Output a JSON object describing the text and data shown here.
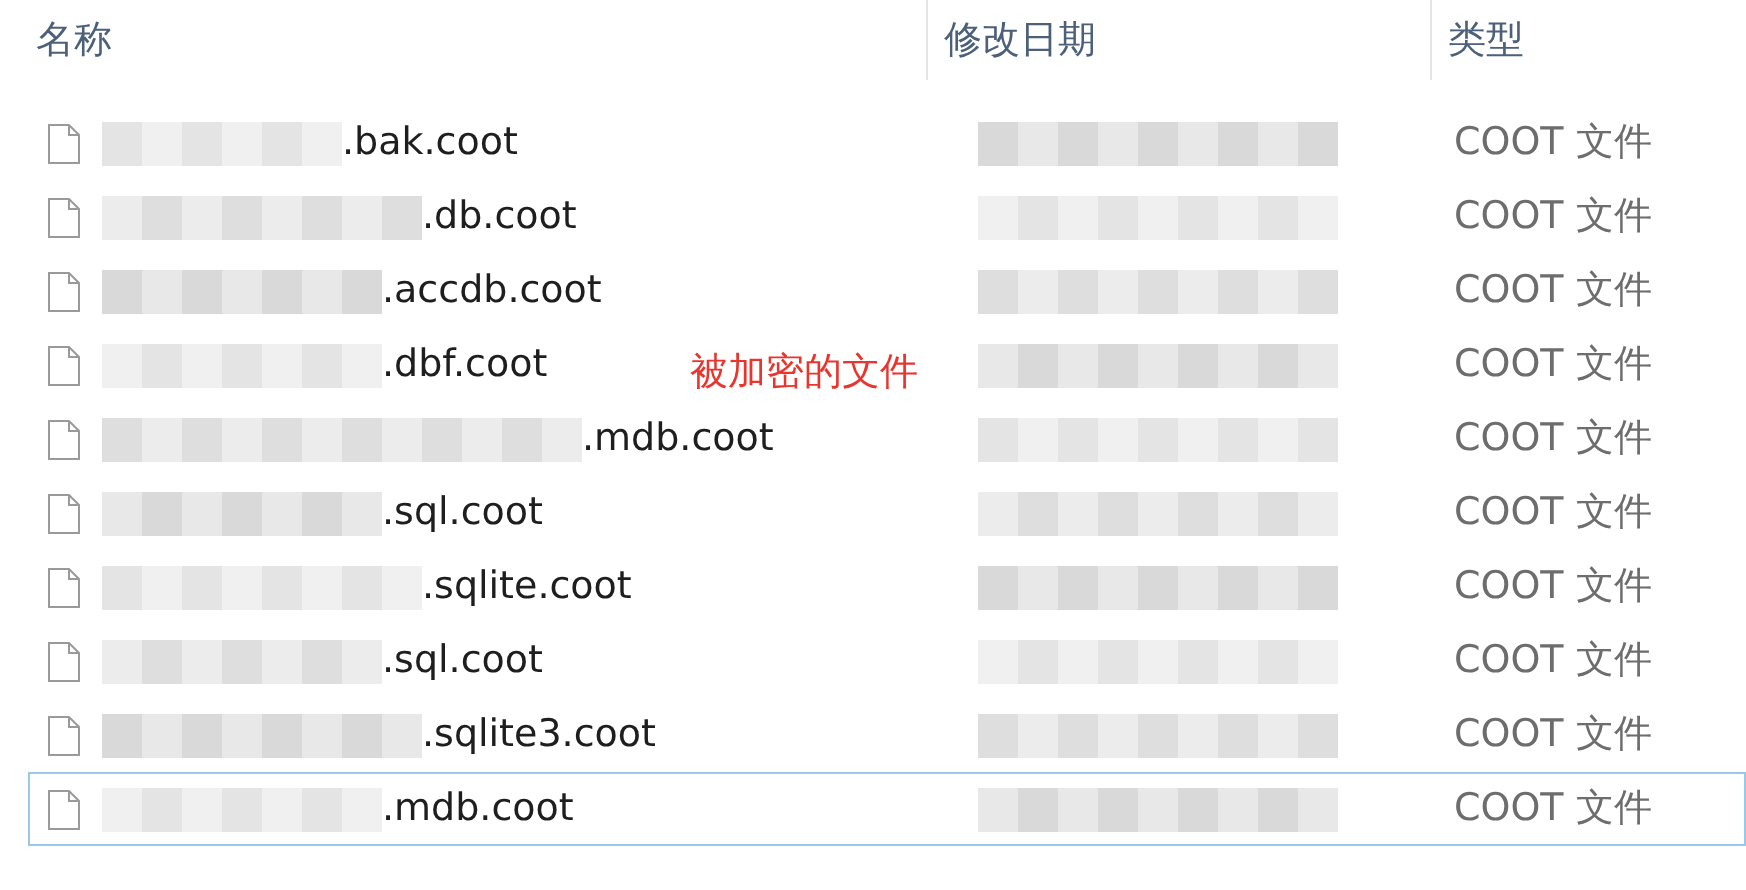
{
  "columns": [
    {
      "label": "名称"
    },
    {
      "label": "修改日期"
    },
    {
      "label": "类型"
    }
  ],
  "rows": [
    {
      "name": ".bak.coot",
      "type": "COOT 文件",
      "focused": false
    },
    {
      "name": ".db.coot",
      "type": "COOT 文件",
      "focused": false
    },
    {
      "name": ".accdb.coot",
      "type": "COOT 文件",
      "focused": false
    },
    {
      "name": ".dbf.coot",
      "type": "COOT 文件",
      "focused": false
    },
    {
      "name": ".mdb.coot",
      "type": "COOT 文件",
      "focused": false
    },
    {
      "name": ".sql.coot",
      "type": "COOT 文件",
      "focused": false
    },
    {
      "name": ".sqlite.coot",
      "type": "COOT 文件",
      "focused": false
    },
    {
      "name": ".sql.coot",
      "type": "COOT 文件",
      "focused": false
    },
    {
      "name": ".sqlite3.coot",
      "type": "COOT 文件",
      "focused": false
    },
    {
      "name": ".mdb.coot",
      "type": "COOT 文件",
      "focused": true
    }
  ],
  "annotation": "被加密的文件"
}
